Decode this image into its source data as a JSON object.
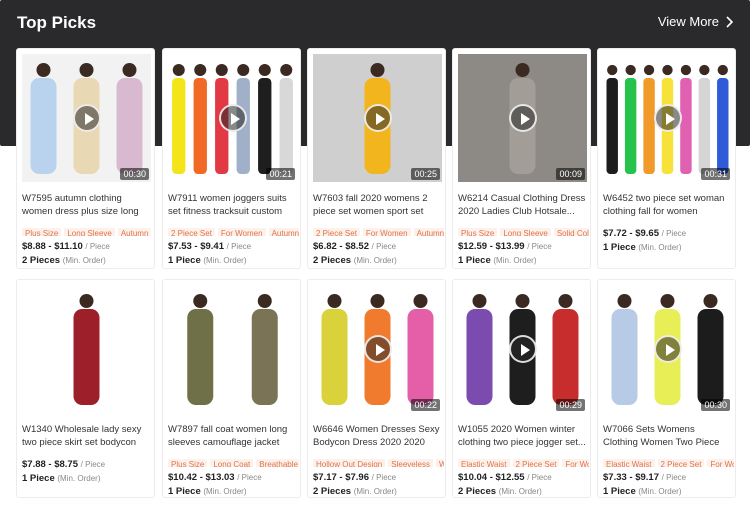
{
  "section": {
    "title": "Top Picks",
    "view_more": "View More"
  },
  "products": [
    {
      "name": "W7595 autumn clothing women dress plus size long sleeve dress",
      "tags": [
        "Plus Size",
        "Long Sleeve",
        "Autumn"
      ],
      "price": "$8.88 - $11.10",
      "price_unit": "/ Piece",
      "moq": "2 Pieces",
      "moq_label": "(Min. Order)",
      "duration": "00:30",
      "has_video": true,
      "bg": "#f2f2f2",
      "palette": [
        "#b9d3ef",
        "#e9d8b4",
        "#d9b9cf"
      ]
    },
    {
      "name": "W7911 women joggers suits set fitness tracksuit custom two...",
      "tags": [
        "2 Piece Set",
        "For Women",
        "Autumn"
      ],
      "price": "$7.53 - $9.41",
      "price_unit": "/ Piece",
      "moq": "1 Piece",
      "moq_label": "(Min. Order)",
      "duration": "00:21",
      "has_video": true,
      "bg": "#ffffff",
      "palette": [
        "#f3e51a",
        "#f06a26",
        "#e23a44",
        "#9fb0c8",
        "#1e1e1e",
        "#d8d8d8"
      ]
    },
    {
      "name": "W7603 fall 2020 womens 2 piece set women sport set women",
      "tags": [
        "2 Piece Set",
        "For Women",
        "Autumn"
      ],
      "price": "$6.82 - $8.52",
      "price_unit": "/ Piece",
      "moq": "2 Pieces",
      "moq_label": "(Min. Order)",
      "duration": "00:25",
      "has_video": true,
      "bg": "#cfcfcf",
      "palette": [
        "#f3b51d"
      ]
    },
    {
      "name": "W6214 Casual Clothing Dress 2020 Ladies Club Hotsale...",
      "tags": [
        "Plus Size",
        "Long Sleeve",
        "Solid Color"
      ],
      "price": "$12.59 - $13.99",
      "price_unit": "/ Piece",
      "moq": "1 Piece",
      "moq_label": "(Min. Order)",
      "duration": "00:09",
      "has_video": true,
      "bg": "#8d8984",
      "palette": [
        "#a29d97"
      ]
    },
    {
      "name": "W6452 two piece set woman clothing fall for women tracksuit...",
      "tags": [],
      "price": "$7.72 - $9.65",
      "price_unit": "/ Piece",
      "moq": "1 Piece",
      "moq_label": "(Min. Order)",
      "duration": "00:31",
      "has_video": true,
      "bg": "#ffffff",
      "palette": [
        "#1d1d1d",
        "#27c24c",
        "#f09a2a",
        "#f7e23a",
        "#e060b2",
        "#d5d5d5",
        "#2f5bd8"
      ]
    },
    {
      "name": "W1340 Wholesale lady sexy two piece skirt set bodycon evening...",
      "tags": [],
      "price": "$7.88 - $8.75",
      "price_unit": "/ Piece",
      "moq": "1 Piece",
      "moq_label": "(Min. Order)",
      "duration": "",
      "has_video": false,
      "bg": "#ffffff",
      "palette": [
        "#9c1f2a"
      ]
    },
    {
      "name": "W7897 fall coat women long sleeves camouflage jacket plus...",
      "tags": [
        "Plus Size",
        "Long Coat",
        "Breathable"
      ],
      "price": "$10.42 - $13.03",
      "price_unit": "/ Piece",
      "moq": "1 Piece",
      "moq_label": "(Min. Order)",
      "duration": "",
      "has_video": false,
      "bg": "#ffffff",
      "palette": [
        "#6f7047",
        "#7a7355"
      ]
    },
    {
      "name": "W6646 Women Dresses Sexy Bodycon Dress 2020 2020 New...",
      "tags": [
        "Hollow Out Design",
        "Sleeveless",
        "With"
      ],
      "price": "$7.17 - $7.96",
      "price_unit": "/ Piece",
      "moq": "2 Pieces",
      "moq_label": "(Min. Order)",
      "duration": "00:22",
      "has_video": true,
      "bg": "#ffffff",
      "palette": [
        "#d9d23a",
        "#f07a2e",
        "#e45fa8"
      ]
    },
    {
      "name": "W1055 2020 Women winter clothing two piece jogger set...",
      "tags": [
        "Elastic Waist",
        "2 Piece Set",
        "For Wom"
      ],
      "price": "$10.04 - $12.55",
      "price_unit": "/ Piece",
      "moq": "2 Pieces",
      "moq_label": "(Min. Order)",
      "duration": "00:29",
      "has_video": true,
      "bg": "#ffffff",
      "palette": [
        "#7b4bb0",
        "#1e1e1e",
        "#c82d2d"
      ]
    },
    {
      "name": "W7066 Sets Womens Clothing Women Two Piece Set 2 Piece...",
      "tags": [
        "Elastic Waist",
        "2 Piece Set",
        "For Wom"
      ],
      "price": "$7.33 - $9.17",
      "price_unit": "/ Piece",
      "moq": "1 Piece",
      "moq_label": "(Min. Order)",
      "duration": "00:30",
      "has_video": true,
      "bg": "#ffffff",
      "palette": [
        "#b7cbe6",
        "#e8ee55",
        "#1c1c1c"
      ]
    }
  ]
}
